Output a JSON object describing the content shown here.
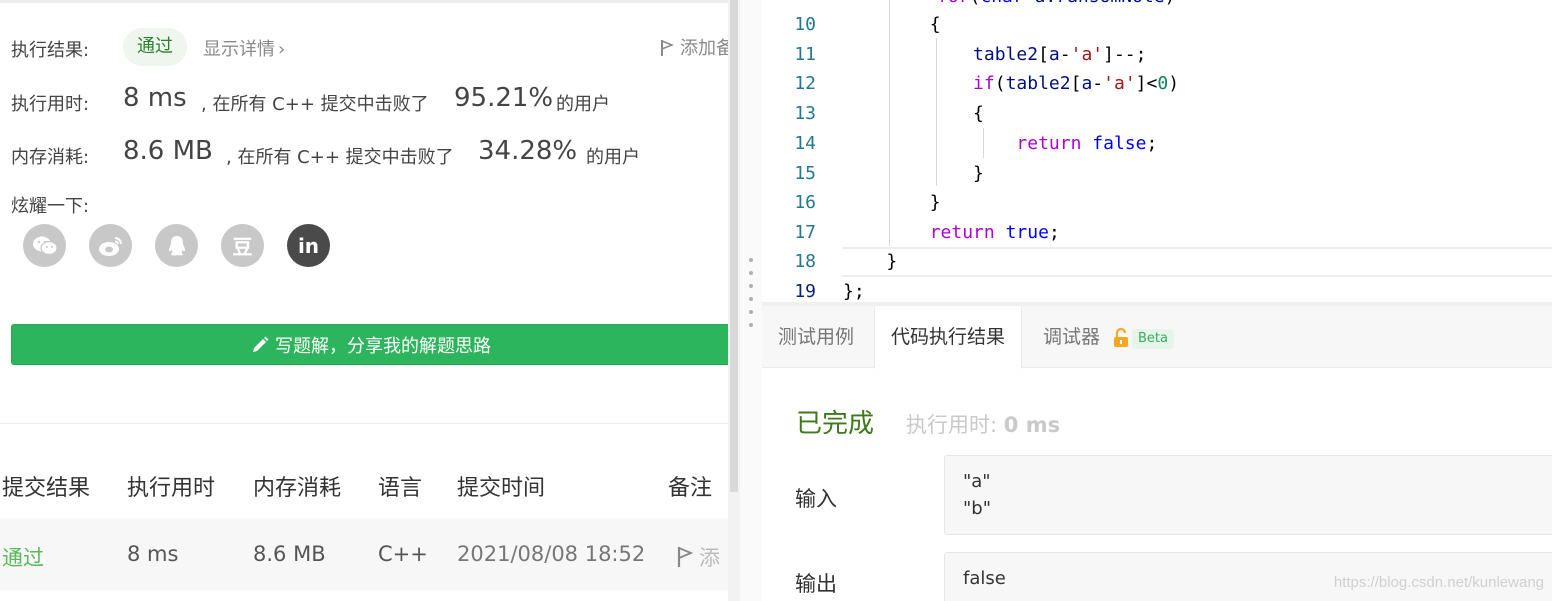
{
  "submission": {
    "result_label": "执行结果:",
    "result_badge": "通过",
    "details_link": "显示详情",
    "add_note": "添加备注",
    "runtime_label": "执行用时:",
    "runtime_value": "8 ms",
    "runtime_beat_text": ", 在所有 C++ 提交中击败了",
    "runtime_percent": "95.21%",
    "runtime_suffix": "的用户",
    "memory_label": "内存消耗:",
    "memory_value": "8.6 MB",
    "memory_beat_text": ", 在所有 C++ 提交中击败了",
    "memory_percent": "34.28%",
    "memory_suffix": "的用户",
    "share_label": "炫耀一下:",
    "share_icons": [
      "wechat-icon",
      "weibo-icon",
      "qq-icon",
      "douban-icon",
      "linkedin-icon"
    ],
    "share_glyphs": {
      "douban": "豆",
      "linkedin": "in"
    },
    "write_solution_button": "写题解，分享我的解题思路"
  },
  "history_table": {
    "headers": [
      "提交结果",
      "执行用时",
      "内存消耗",
      "语言",
      "提交时间",
      "备注"
    ],
    "rows": [
      {
        "result": "通过",
        "runtime": "8 ms",
        "memory": "8.6 MB",
        "language": "C++",
        "time": "2021/08/08 18:52",
        "note": "添"
      }
    ]
  },
  "editor": {
    "line_numbers": [
      "10",
      "11",
      "12",
      "13",
      "14",
      "15",
      "16",
      "17",
      "18",
      "19"
    ],
    "partial_top_line": "for(char a:ransomNote)"
  },
  "console": {
    "tabs": [
      "测试用例",
      "代码执行结果",
      "调试器"
    ],
    "active_tab": "代码执行结果",
    "beta_badge": "Beta",
    "status": "已完成",
    "exec_time_label": "执行用时:",
    "exec_time_value": "0 ms",
    "input_label": "输入",
    "input_lines": [
      "\"a\"",
      "\"b\""
    ],
    "output_label": "输出",
    "output_value": "false"
  },
  "watermark": "https://blog.csdn.net/kunlewang",
  "colors": {
    "accent_green": "#2db55d",
    "pass_green": "#5cb85c",
    "status_green": "#3d7a1c",
    "lock_orange": "#f5a623"
  }
}
